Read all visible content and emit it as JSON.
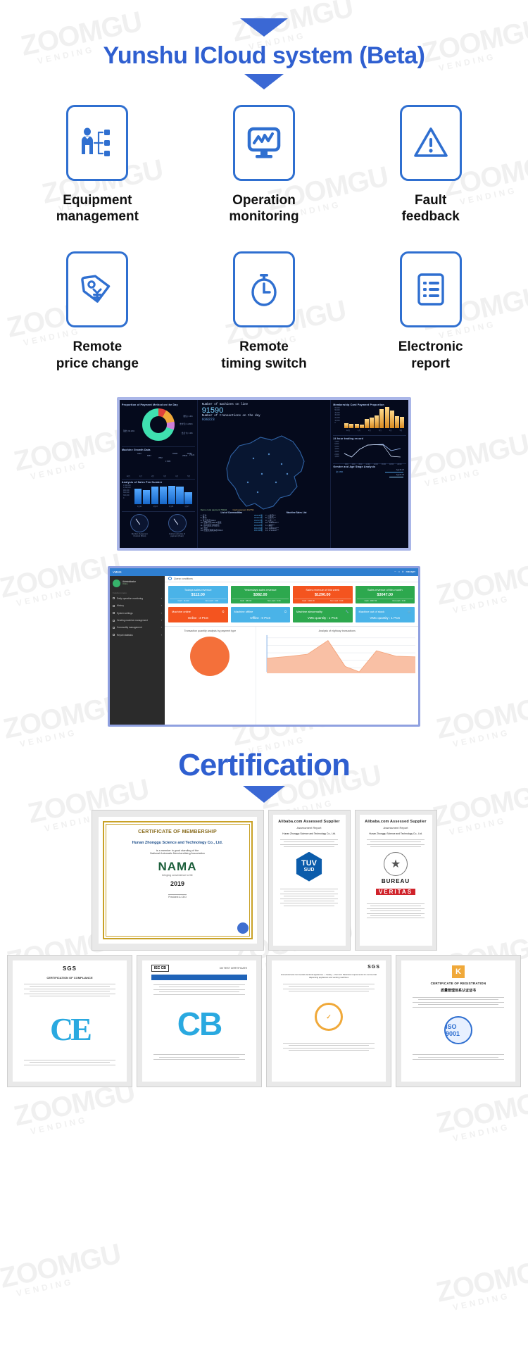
{
  "hero": {
    "title": "Yunshu ICloud system (Beta)",
    "accent_color": "#2f5fd0"
  },
  "features": [
    {
      "label_line1": "Equipment",
      "label_line2": "management",
      "icon": "org-person-icon"
    },
    {
      "label_line1": "Operation",
      "label_line2": "monitoring",
      "icon": "monitor-chart-icon"
    },
    {
      "label_line1": "Fault",
      "label_line2": "feedback",
      "icon": "warning-triangle-icon"
    },
    {
      "label_line1": "Remote",
      "label_line2": "price change",
      "icon": "price-tag-yuan-icon"
    },
    {
      "label_line1": "Remote",
      "label_line2": "timing switch",
      "icon": "stopwatch-icon"
    },
    {
      "label_line1": "Electronic",
      "label_line2": "report",
      "icon": "report-list-icon"
    }
  ],
  "dashboard": {
    "left_panels": [
      {
        "title": "Proportion of Payment Method on the Day",
        "legend": [
          "微信 | 2.4%",
          "支付宝 | 11.81%",
          "现金 | 66.23%",
          "会员卡 | 3.0%"
        ]
      },
      {
        "title": "Machine Growth Data",
        "bar_labels": [
          "4240",
          "8687",
          "3582",
          "17380",
          "65380",
          "8471",
          "25842",
          "27422",
          "26672",
          "43380",
          "15139",
          "8888"
        ],
        "axis": [
          "12月",
          "1月",
          "2月",
          "3月",
          "4月",
          "5月"
        ]
      },
      {
        "title": "Analysis of Sales Pen Number",
        "y_labels": [
          "1,500,000",
          "1,200,000",
          "900,000",
          "600,000",
          "300,000",
          "0"
        ],
        "axis": [
          "4月21",
          "4月23",
          "4月25",
          "4月27"
        ]
      }
    ],
    "gauges": [
      {
        "caption_line1": "Number of payment",
        "caption_line2": "/ Current (Pens)"
      },
      {
        "caption_line1": "Current unit price of",
        "caption_line2": "payment (Yuan)"
      }
    ],
    "center": {
      "label_machines": "Number of machines on line",
      "value_machines": "91590",
      "label_transactions": "Number of transactions on the day",
      "value_transactions": "930223",
      "pay_legend": [
        "Demo code payment  791111",
        "Cash payment  132791"
      ]
    },
    "list_left": {
      "title": "List of Commodities",
      "rows": [
        {
          "n": "7. 红牛",
          "v": "353440笔"
        },
        {
          "n": "8. 脉动",
          "v": "334213笔"
        },
        {
          "n": "9. 可口可乐330ml",
          "v": "342421笔"
        },
        {
          "n": "10. 百事可乐330ml 瓶装",
          "v": "330295笔"
        },
        {
          "n": "11. 达利园法式软面包",
          "v": "933428笔"
        },
        {
          "n": "12. 雪碧",
          "v": "931609笔"
        },
        {
          "n": "13. 怡宝饮用纯净水550ml",
          "v": "931308笔"
        }
      ]
    },
    "list_right": {
      "title": "Machine Sales List",
      "rows": [
        {
          "n": "7. 公寓四***",
          "v": ""
        },
        {
          "n": "8. 公寓六***",
          "v": ""
        },
        {
          "n": "9. 公寓二***",
          "v": ""
        },
        {
          "n": "10. 1688100***",
          "v": ""
        },
        {
          "n": "11. 编楼***",
          "v": ""
        },
        {
          "n": "12. 1688100***",
          "v": ""
        },
        {
          "n": "13. 1712100***",
          "v": ""
        }
      ]
    },
    "right_panels": [
      {
        "title": "Membership Card Payment Proportion",
        "y_labels": [
          "60,000",
          "50,000",
          "40,000",
          "30,000",
          "20,000",
          "10,000",
          "0"
        ],
        "axis": [
          "12月",
          "1月",
          "2月",
          "3月",
          "4月",
          "5月"
        ],
        "values": [
          14000,
          11000,
          11500,
          10000,
          24000,
          29000,
          35000,
          52000,
          58000,
          48000,
          32000,
          30000
        ]
      },
      {
        "title": "24 hour trading record",
        "y_labels": [
          "7,000",
          "6,000",
          "5,000",
          "4,000",
          "3,000",
          "2,000",
          "1,000"
        ],
        "axis": [
          "0:00",
          "4:00",
          "8:00",
          "12:00",
          "14:00",
          "16:00",
          "18:00",
          "22:00"
        ],
        "values": [
          2600,
          1200,
          3200,
          6200,
          6300,
          6500,
          6100,
          4400
        ]
      },
      {
        "title": "Gender and Age Stage Analysis",
        "legend": [
          "Age18-20",
          "Age20-30",
          "女 | 39%"
        ]
      }
    ]
  },
  "vmms": {
    "window_title": "VMMS",
    "top_right_text": "manager",
    "user_name": "Administrator",
    "user_status": "Online",
    "menu_section": "Function menu",
    "menu": [
      "Daily operation monitoring",
      "History",
      "System settings",
      "Vending machine management",
      "Commodity management",
      "Report statistics"
    ],
    "query_label": "Query conditions",
    "kpis": [
      {
        "title": "Todays sales revenue",
        "value": "$112.00",
        "f1": "Cash : 112.00",
        "f2": "Non-cash : 0.00",
        "color": "#4ab3e8"
      },
      {
        "title": "Yesterdays sales revenue",
        "value": "$382.00",
        "f1": "Cash : 382.00",
        "f2": "Non-cash : 0.00",
        "color": "#2da84e"
      },
      {
        "title": "Sales revenue of this week",
        "value": "$1290.00",
        "f1": "Cash : 1290.00",
        "f2": "Non-cash : 0.00",
        "color": "#f4541f"
      },
      {
        "title": "Sales revenue of this month",
        "value": "$3047.00",
        "f1": "Cash : 3047.00",
        "f2": "Non-cash : 0.00",
        "color": "#2da84e"
      }
    ],
    "kpis2": [
      {
        "title": "Machine online",
        "value": "Online : 3 PCS",
        "color": "#f4541f",
        "icon": "signal-icon"
      },
      {
        "title": "Machine offline",
        "value": "Offline : 0 PCS",
        "color": "#4ab3e8",
        "icon": "power-icon"
      },
      {
        "title": "Machine abnormality",
        "value": "VMC quantity : 1 PCS",
        "color": "#2da84e",
        "icon": "wrench-icon"
      },
      {
        "title": "Machine out of stock",
        "value": "VMC quantity : 1 PCS",
        "color": "#4ab3e8",
        "icon": "cart-icon"
      }
    ],
    "chart_left_title": "Transaction quantity analysis by payment type",
    "chart_right_title": "Analysis of eightoay transactions"
  },
  "certification": {
    "title": "Certification",
    "items": [
      {
        "name": "nama-membership",
        "title": "CERTIFICATE OF MEMBERSHIP",
        "company": "Hunan Zhonggu Science and Technology Co., Ltd.",
        "body1": "is a member in good standing of the",
        "body2": "National Automatic Merchandising Association",
        "logo": "NAMA",
        "tagline": "bringing convenience to life",
        "year": "2019",
        "sign_name": "President & CEO"
      },
      {
        "name": "tuv-assessed-supplier",
        "title": "Alibaba.com Assessed Supplier",
        "subtitle": "Assessment Report",
        "company": "Hunan Zhonggu Science and Technology Co., Ltd.",
        "logo_a": "TUV",
        "logo_b": "SUD"
      },
      {
        "name": "bureau-veritas-assessed-supplier",
        "title": "Alibaba.com Assessed Supplier",
        "subtitle": "Assessment Report",
        "company": "Hunan Zhonggu Science and Technology Co., Ltd.",
        "logo_a": "BUREAU",
        "logo_b": "VERITAS"
      },
      {
        "name": "sgs-ce-certificate",
        "title": "SGS",
        "subtitle": "CERTIFICATION OF COMPLIANCE",
        "logo": "CE"
      },
      {
        "name": "cb-certificate",
        "title": "IEC CB",
        "subtitle": "CB TEST CERTIFICATE",
        "logo": "CB"
      },
      {
        "name": "sgs-certificate",
        "title": "SGS",
        "subtitle": "Household and commercial electrical appliances — Safety — Part 1/3: Particular requirements for commercial dispensing appliances and vending machines",
        "logo": "SGS"
      },
      {
        "name": "iso-registration-certificate",
        "title": "CERTIFICATE OF REGISTRATION",
        "subtitle": "质量管理体系认证证书",
        "logo": "ISO 9001"
      }
    ]
  },
  "watermark": {
    "big": "ZOOMGU",
    "small": "VENDING"
  }
}
